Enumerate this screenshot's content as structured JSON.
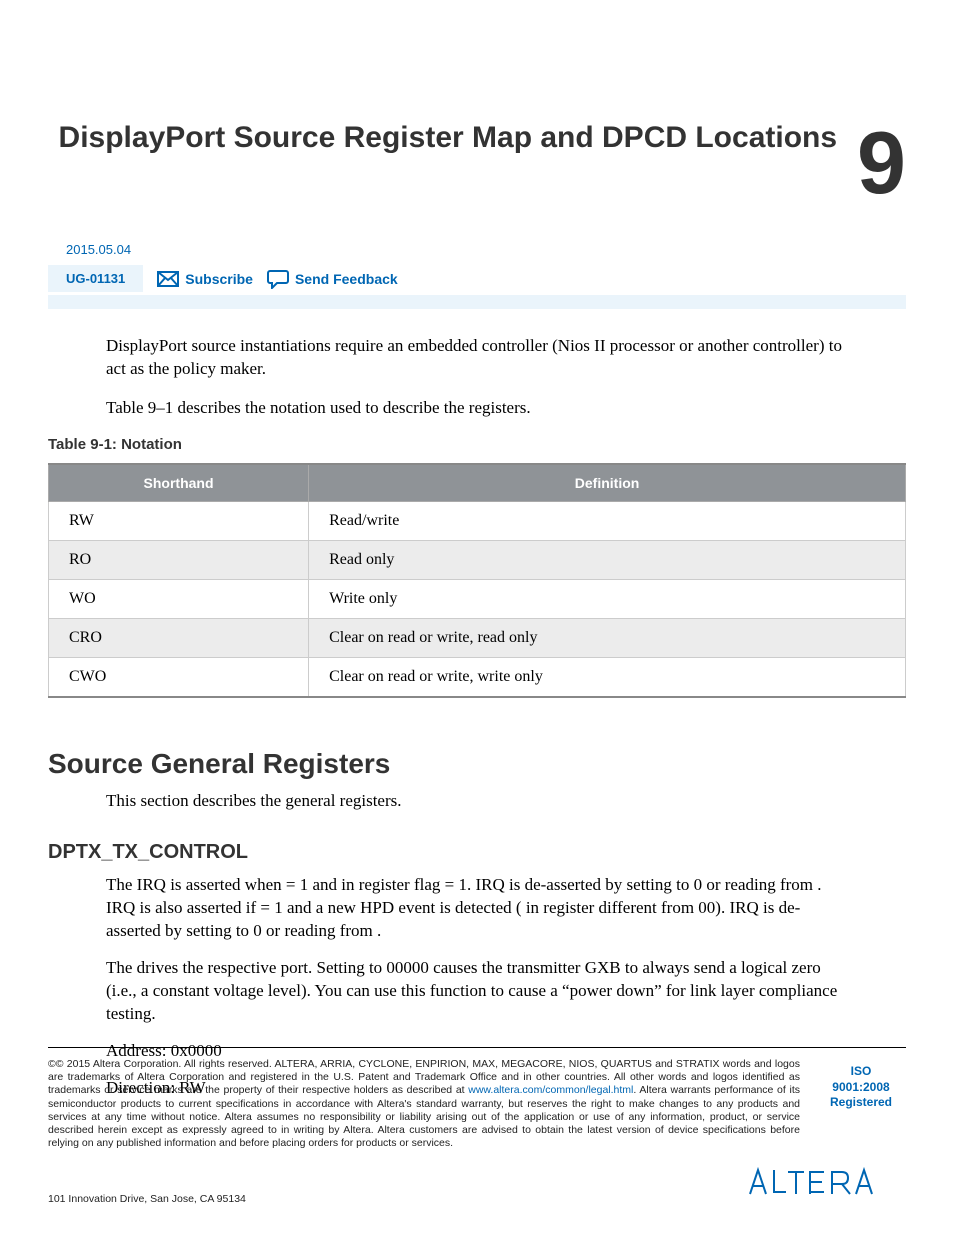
{
  "chapter": {
    "title": "DisplayPort Source Register Map and DPCD Locations",
    "number": "9"
  },
  "meta": {
    "date": "2015.05.04",
    "doc_id": "UG-01131",
    "subscribe": "Subscribe",
    "feedback": "Send Feedback"
  },
  "intro": {
    "p1": "DisplayPort source instantiations require an embedded controller (Nios II processor or another controller) to act as the policy maker.",
    "p2": "Table 9–1 describes the notation used to describe the registers."
  },
  "table": {
    "caption": "Table 9-1: Notation",
    "headers": {
      "c1": "Shorthand",
      "c2": "Definition"
    },
    "rows": [
      {
        "s": "RW",
        "d": "Read/write"
      },
      {
        "s": "RO",
        "d": "Read only"
      },
      {
        "s": "WO",
        "d": "Write only"
      },
      {
        "s": "CRO",
        "d": "Clear on read or write, read only"
      },
      {
        "s": "CWO",
        "d": "Clear on read or write, write only"
      }
    ]
  },
  "section": {
    "h1": "Source General Registers",
    "p": "This section describes the general registers.",
    "h2": "DPTX_TX_CONTROL",
    "r1": "The IRQ is asserted when                               = 1 and in register                                       flag                  = 1. IRQ is de-asserted by setting                               to 0 or reading from                                       . IRQ is also asserted if                      = 1 and a new HPD event is detected (                     in register                                       different from 00). IRQ is de-asserted by setting                               to 0 or reading from                                       .",
    "r2": "The                          drives the respective                          port. Setting                          to 00000 causes the transmitter GXB to always send a logical zero (i.e., a constant voltage level). You can use this function to cause a “power down” for link layer compliance testing.",
    "addr": "Address: 0x0000",
    "dir": "Direction: RW"
  },
  "footer": {
    "copyright_pre": "© 2015 Altera Corporation. All rights reserved. ALTERA, ARRIA, CYCLONE, ENPIRION, MAX, MEGACORE, NIOS, QUARTUS and STRATIX words and logos are trademarks of Altera Corporation and registered in the U.S. Patent and Trademark Office and in other countries. All other words and logos identified as trademarks or service marks are the property of their respective holders as described at ",
    "link_text": "www.altera.com/common/legal.html",
    "copyright_post": ". Altera warrants performance of its semiconductor products to current specifications in accordance with Altera's standard warranty, but reserves the right to make changes to any products and services at any time without notice. Altera assumes no responsibility or liability arising out of the application or use of any information, product, or service described herein except as expressly agreed to in writing by Altera. Altera customers are advised to obtain the latest version of device specifications before relying on any published information and before placing orders for products or services.",
    "iso1": "ISO",
    "iso2": "9001:2008",
    "iso3": "Registered",
    "address": "101 Innovation Drive, San Jose, CA 95134"
  }
}
